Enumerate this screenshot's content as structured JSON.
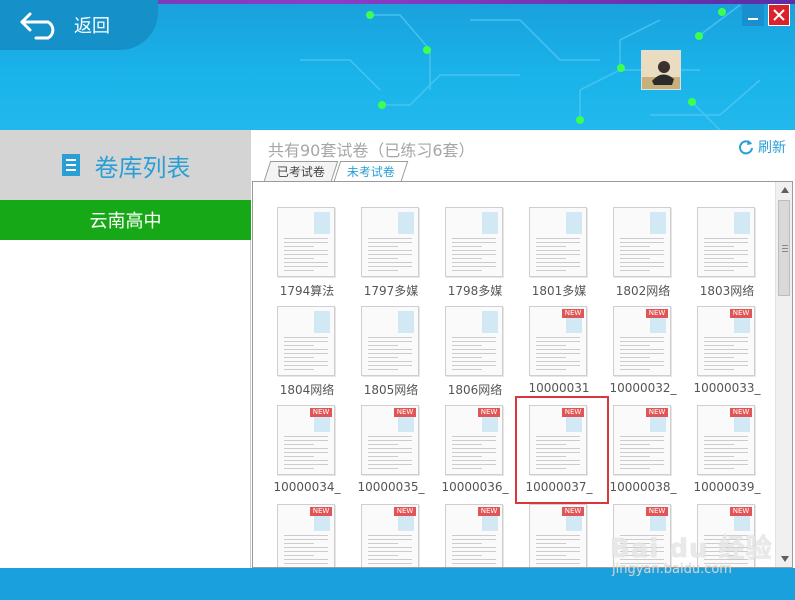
{
  "header": {
    "back_label": "返回"
  },
  "sidebar": {
    "title": "卷库列表",
    "items": [
      {
        "label": "云南高中"
      }
    ]
  },
  "main": {
    "count_text": "共有90套试卷（已练习6套）",
    "refresh_label": "刷新",
    "tabs": [
      {
        "label": "已考试卷"
      },
      {
        "label": "未考试卷"
      }
    ],
    "active_tab": 1
  },
  "papers": [
    {
      "label": "1794算法",
      "is_new": false
    },
    {
      "label": "1797多媒",
      "is_new": false
    },
    {
      "label": "1798多媒",
      "is_new": false
    },
    {
      "label": "1801多媒",
      "is_new": false
    },
    {
      "label": "1802网络",
      "is_new": false
    },
    {
      "label": "1803网络",
      "is_new": false
    },
    {
      "label": "1804网络",
      "is_new": false
    },
    {
      "label": "1805网络",
      "is_new": false
    },
    {
      "label": "1806网络",
      "is_new": false
    },
    {
      "label": "10000031",
      "is_new": true
    },
    {
      "label": "10000032_",
      "is_new": true
    },
    {
      "label": "10000033_",
      "is_new": true
    },
    {
      "label": "10000034_",
      "is_new": true
    },
    {
      "label": "10000035_",
      "is_new": true
    },
    {
      "label": "10000036_",
      "is_new": true
    },
    {
      "label": "10000037_",
      "is_new": true,
      "selected": true
    },
    {
      "label": "10000038_",
      "is_new": true
    },
    {
      "label": "10000039_",
      "is_new": true
    },
    {
      "label": "",
      "is_new": true
    },
    {
      "label": "",
      "is_new": true
    },
    {
      "label": "",
      "is_new": true
    },
    {
      "label": "",
      "is_new": true
    },
    {
      "label": "",
      "is_new": true
    },
    {
      "label": "",
      "is_new": true
    }
  ],
  "badge_text": "NEW",
  "watermark": {
    "brand": "Bai du 经验",
    "url": "jingyan.baidu.com"
  },
  "colors": {
    "header_blue": "#1ab4ea",
    "sidebar_active": "#17a817",
    "accent": "#2a9fd6",
    "close_red": "#d9222a",
    "badge_red": "#e05555"
  },
  "icons": {
    "back": "back-arrow-icon",
    "minimize": "minimize-icon",
    "close": "close-icon",
    "list": "list-icon",
    "refresh": "refresh-icon"
  }
}
